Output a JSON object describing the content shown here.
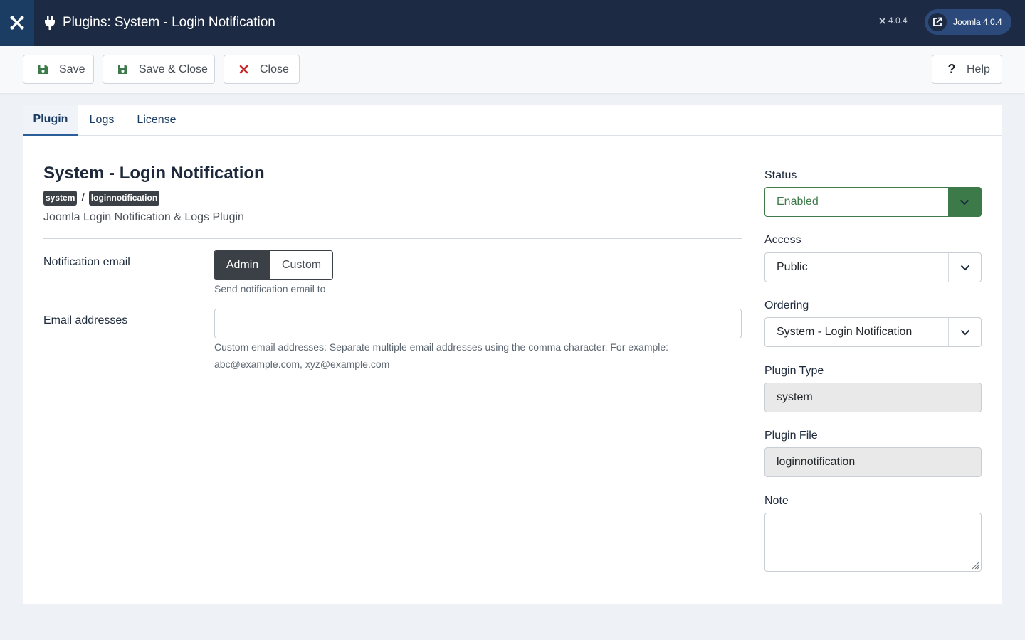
{
  "header": {
    "title": "Plugins: System - Login Notification",
    "version": "4.0.4",
    "site_link_label": "Joomla 4.0.4",
    "logo_icon": "joomla-logo-icon",
    "title_icon": "plug-icon",
    "colors": {
      "background": "#1c2a43",
      "logo_background": "#1c3d63",
      "site_link": "#2b4a7b"
    }
  },
  "toolbar": {
    "save_label": "Save",
    "save_close_label": "Save & Close",
    "close_label": "Close",
    "help_label": "Help"
  },
  "tabs": [
    {
      "label": "Plugin",
      "active": true
    },
    {
      "label": "Logs",
      "active": false
    },
    {
      "label": "License",
      "active": false
    }
  ],
  "plugin": {
    "title": "System - Login Notification",
    "folder_badge": "system",
    "element_badge": "loginnotification",
    "badge_separator": "/",
    "description": "Joomla Login Notification & Logs Plugin"
  },
  "fields": {
    "notification_email": {
      "label": "Notification email",
      "options": [
        "Admin",
        "Custom"
      ],
      "selected": "Admin",
      "help": "Send notification email to"
    },
    "email_addresses": {
      "label": "Email addresses",
      "value": "",
      "help_line1": "Custom email addresses: Separate multiple email addresses using the comma character. For example:",
      "help_line2": "abc@example.com, xyz@example.com"
    }
  },
  "sidebar": {
    "status": {
      "label": "Status",
      "value": "Enabled",
      "color": "#3d7a49"
    },
    "access": {
      "label": "Access",
      "value": "Public"
    },
    "ordering": {
      "label": "Ordering",
      "value": "System - Login Notification"
    },
    "plugin_type": {
      "label": "Plugin Type",
      "value": "system"
    },
    "plugin_file": {
      "label": "Plugin File",
      "value": "loginnotification"
    },
    "note": {
      "label": "Note",
      "value": ""
    }
  }
}
